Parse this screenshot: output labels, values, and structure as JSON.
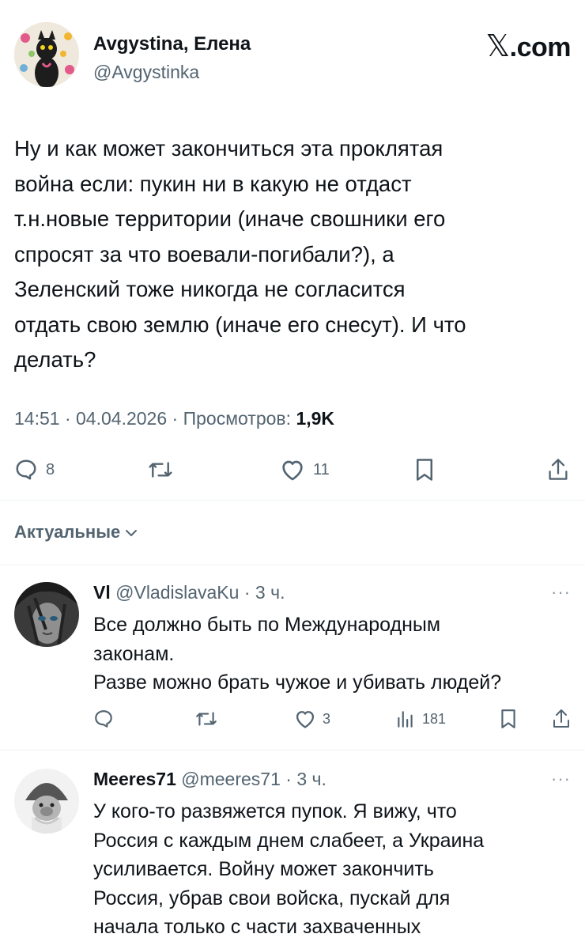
{
  "header": {
    "author_name": "Avgystina, Елена",
    "author_handle": "@Avgystinka",
    "site_logo": "X.com"
  },
  "post": {
    "lines": [
      "Ну  и как может закончиться эта проклятая",
      "война если: пукин ни в какую не отдаст",
      "т.н.новые  территории (иначе свошники его",
      "спросят за что воевали-погибали?), а",
      "Зеленский тоже никогда не согласится",
      "отдать свою землю (иначе его снесут). И что",
      "делать?"
    ],
    "time": "14:51",
    "date": "04.04.2026",
    "views_label": "Просмотров:",
    "views_count": "1,9K",
    "separator": "·",
    "actions": {
      "reply_count": "8",
      "like_count": "11",
      "icons": [
        "reply-icon",
        "repost-icon",
        "like-icon",
        "bookmark-icon",
        "share-icon"
      ]
    }
  },
  "sort": {
    "label": "Актуальные"
  },
  "replies": [
    {
      "name": "Vl",
      "handle": "@VladislavaKu",
      "time": "3 ч.",
      "more": "···",
      "lines": [
        "Все должно быть по Международным",
        "законам.",
        "Разве можно брать чужое и убивать людей?"
      ],
      "like_count": "3",
      "view_count": "181"
    },
    {
      "name": "Meeres71",
      "handle": "@meeres71",
      "time": "3 ч.",
      "more": "···",
      "lines": [
        "У кого-то развяжется пупок. Я вижу, что",
        "Россия с каждым днем слабеет, а Украина",
        "усиливается. Войну может закончить",
        "Россия, убрав свои войска, пускай для",
        "начала только с части захваченных"
      ]
    }
  ],
  "colors": {
    "text": "#0f1419",
    "secondary": "#536471",
    "divider": "#eff3f4"
  }
}
